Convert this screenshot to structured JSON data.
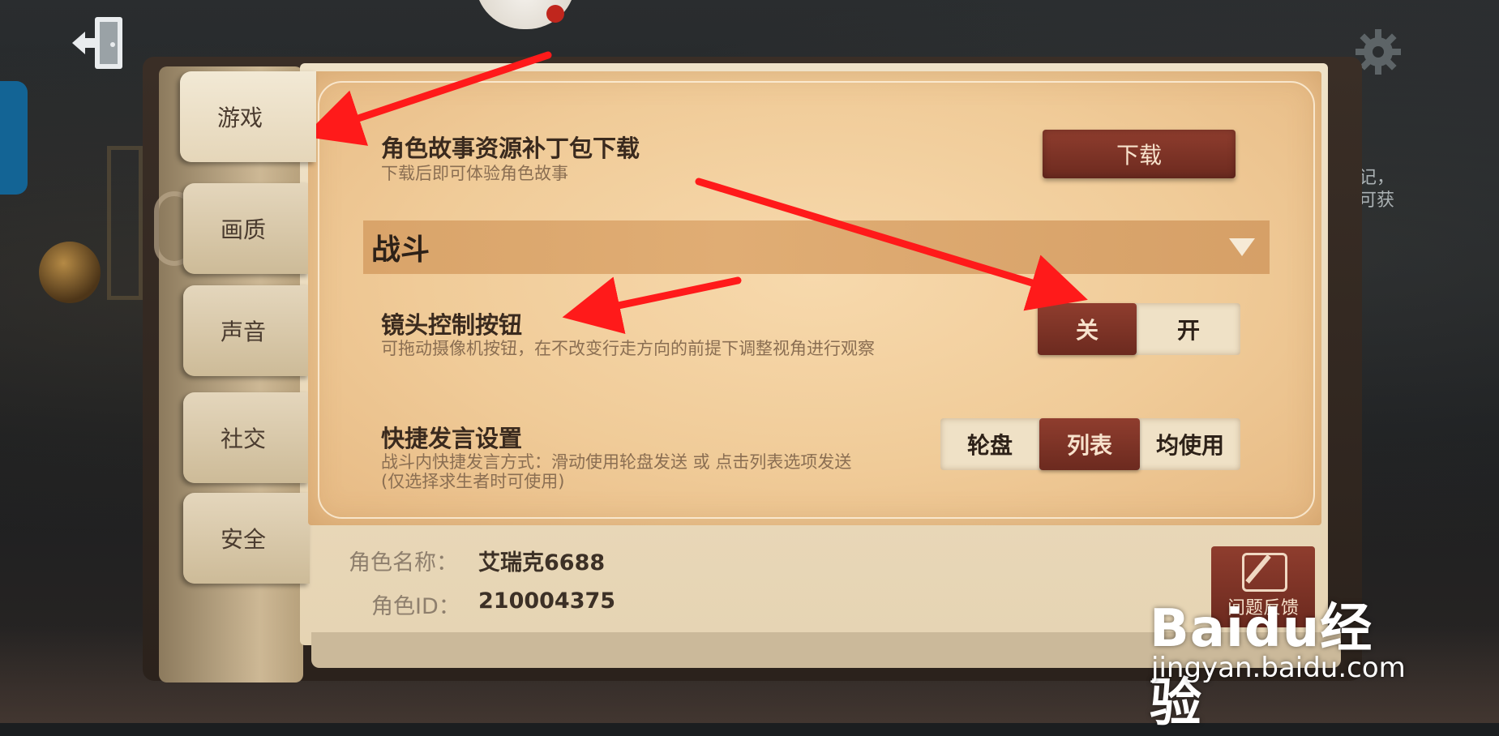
{
  "tabs": [
    {
      "label": "游戏",
      "active": true
    },
    {
      "label": "画质",
      "active": false
    },
    {
      "label": "声音",
      "active": false
    },
    {
      "label": "社交",
      "active": false
    },
    {
      "label": "安全",
      "active": false
    }
  ],
  "story_patch": {
    "title": "角色故事资源补丁包下载",
    "description": "下载后即可体验角色故事",
    "button_label": "下载"
  },
  "section": {
    "title": "战斗"
  },
  "camera_control": {
    "title": "镜头控制按钮",
    "description": "可拖动摄像机按钮，在不改变行走方向的前提下调整视角进行观察",
    "options": [
      "关",
      "开"
    ],
    "selected": "关"
  },
  "quick_chat": {
    "title": "快捷发言设置",
    "description_line1": "战斗内快捷发言方式：滑动使用轮盘发送 或 点击列表选项发送",
    "description_line2": "(仅选择求生者时可使用)",
    "options": [
      "轮盘",
      "列表",
      "均使用"
    ],
    "selected": "列表"
  },
  "account": {
    "name_label": "角色名称：",
    "name_value": "艾瑞克6688",
    "id_label": "角色ID：",
    "id_value": "210004375"
  },
  "feedback": {
    "label": "问题反馈"
  },
  "background": {
    "side_text_line1": "记，",
    "side_text_line2": "可获"
  },
  "watermark": {
    "logo": "Baidu经验",
    "url": "jingyan.baidu.com"
  },
  "colors": {
    "accent_red": "#7a3324",
    "arrow_red": "#ff1a1a",
    "card": "#f2cd9b"
  },
  "icons": [
    "exit-icon",
    "gear-icon",
    "dropdown-triangle-icon",
    "feedback-pen-icon"
  ]
}
